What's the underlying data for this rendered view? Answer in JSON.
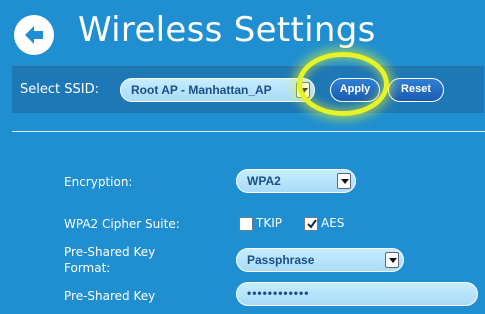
{
  "header": {
    "title": "Wireless Settings",
    "back_icon": "back-arrow-icon"
  },
  "ssid_bar": {
    "label": "Select SSID:",
    "selected_ssid": "Root AP - Manhattan_AP",
    "apply_label": "Apply",
    "reset_label": "Reset"
  },
  "form": {
    "encryption_label": "Encryption:",
    "encryption_value": "WPA2",
    "cipher_label": "WPA2 Cipher Suite:",
    "cipher_options": [
      {
        "label": "TKIP",
        "checked": false
      },
      {
        "label": "AES",
        "checked": true
      }
    ],
    "psk_format_label_line1": "Pre-Shared Key",
    "psk_format_label_line2": "Format:",
    "psk_format_value": "Passphrase",
    "psk_label": "Pre-Shared Key",
    "psk_value": "••••••••••••"
  },
  "colors": {
    "background": "#1f8fd1",
    "highlight": "#e7f326",
    "field": "#b8e4fb",
    "button": "#1a5cb0"
  }
}
